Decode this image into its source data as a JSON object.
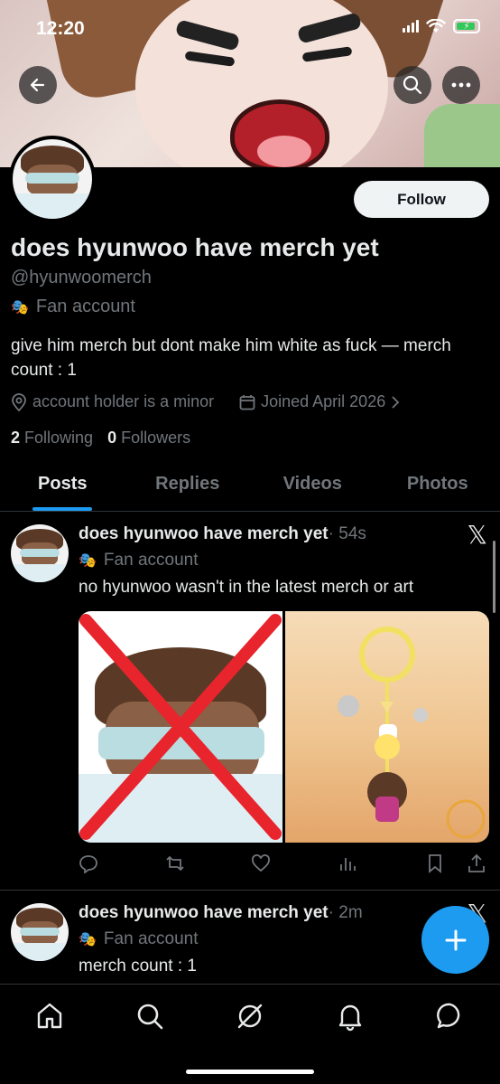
{
  "status_bar": {
    "time": "12:20"
  },
  "profile": {
    "display_name": "does hyunwoo have merch yet",
    "handle": "@hyunwoomerch",
    "label": "Fan account",
    "bio": "give him merch but dont make him white as fuck — merch count : 1",
    "location": "account holder is a minor",
    "joined": "Joined April 2026",
    "following_count": "2",
    "following_label": "Following",
    "followers_count": "0",
    "followers_label": "Followers",
    "follow_button": "Follow"
  },
  "tabs": [
    {
      "label": "Posts",
      "active": true
    },
    {
      "label": "Replies",
      "active": false
    },
    {
      "label": "Videos",
      "active": false
    },
    {
      "label": "Photos",
      "active": false
    }
  ],
  "posts": [
    {
      "author": "does hyunwoo have merch yet",
      "time": "· 54s",
      "label": "Fan account",
      "text": "no hyunwoo wasn't in the latest merch or art"
    },
    {
      "author": "does hyunwoo have merch yet",
      "time": "· 2m",
      "label": "Fan account",
      "text": "merch count : 1"
    }
  ],
  "icons": {
    "back": "back-arrow-icon",
    "search": "search-icon",
    "more": "more-icon",
    "location": "location-pin-icon",
    "calendar": "calendar-icon",
    "compose": "plus-icon"
  },
  "colors": {
    "accent": "#1d9bf0",
    "background": "#000000",
    "text_primary": "#e7e9ea",
    "text_secondary": "#71767b"
  }
}
